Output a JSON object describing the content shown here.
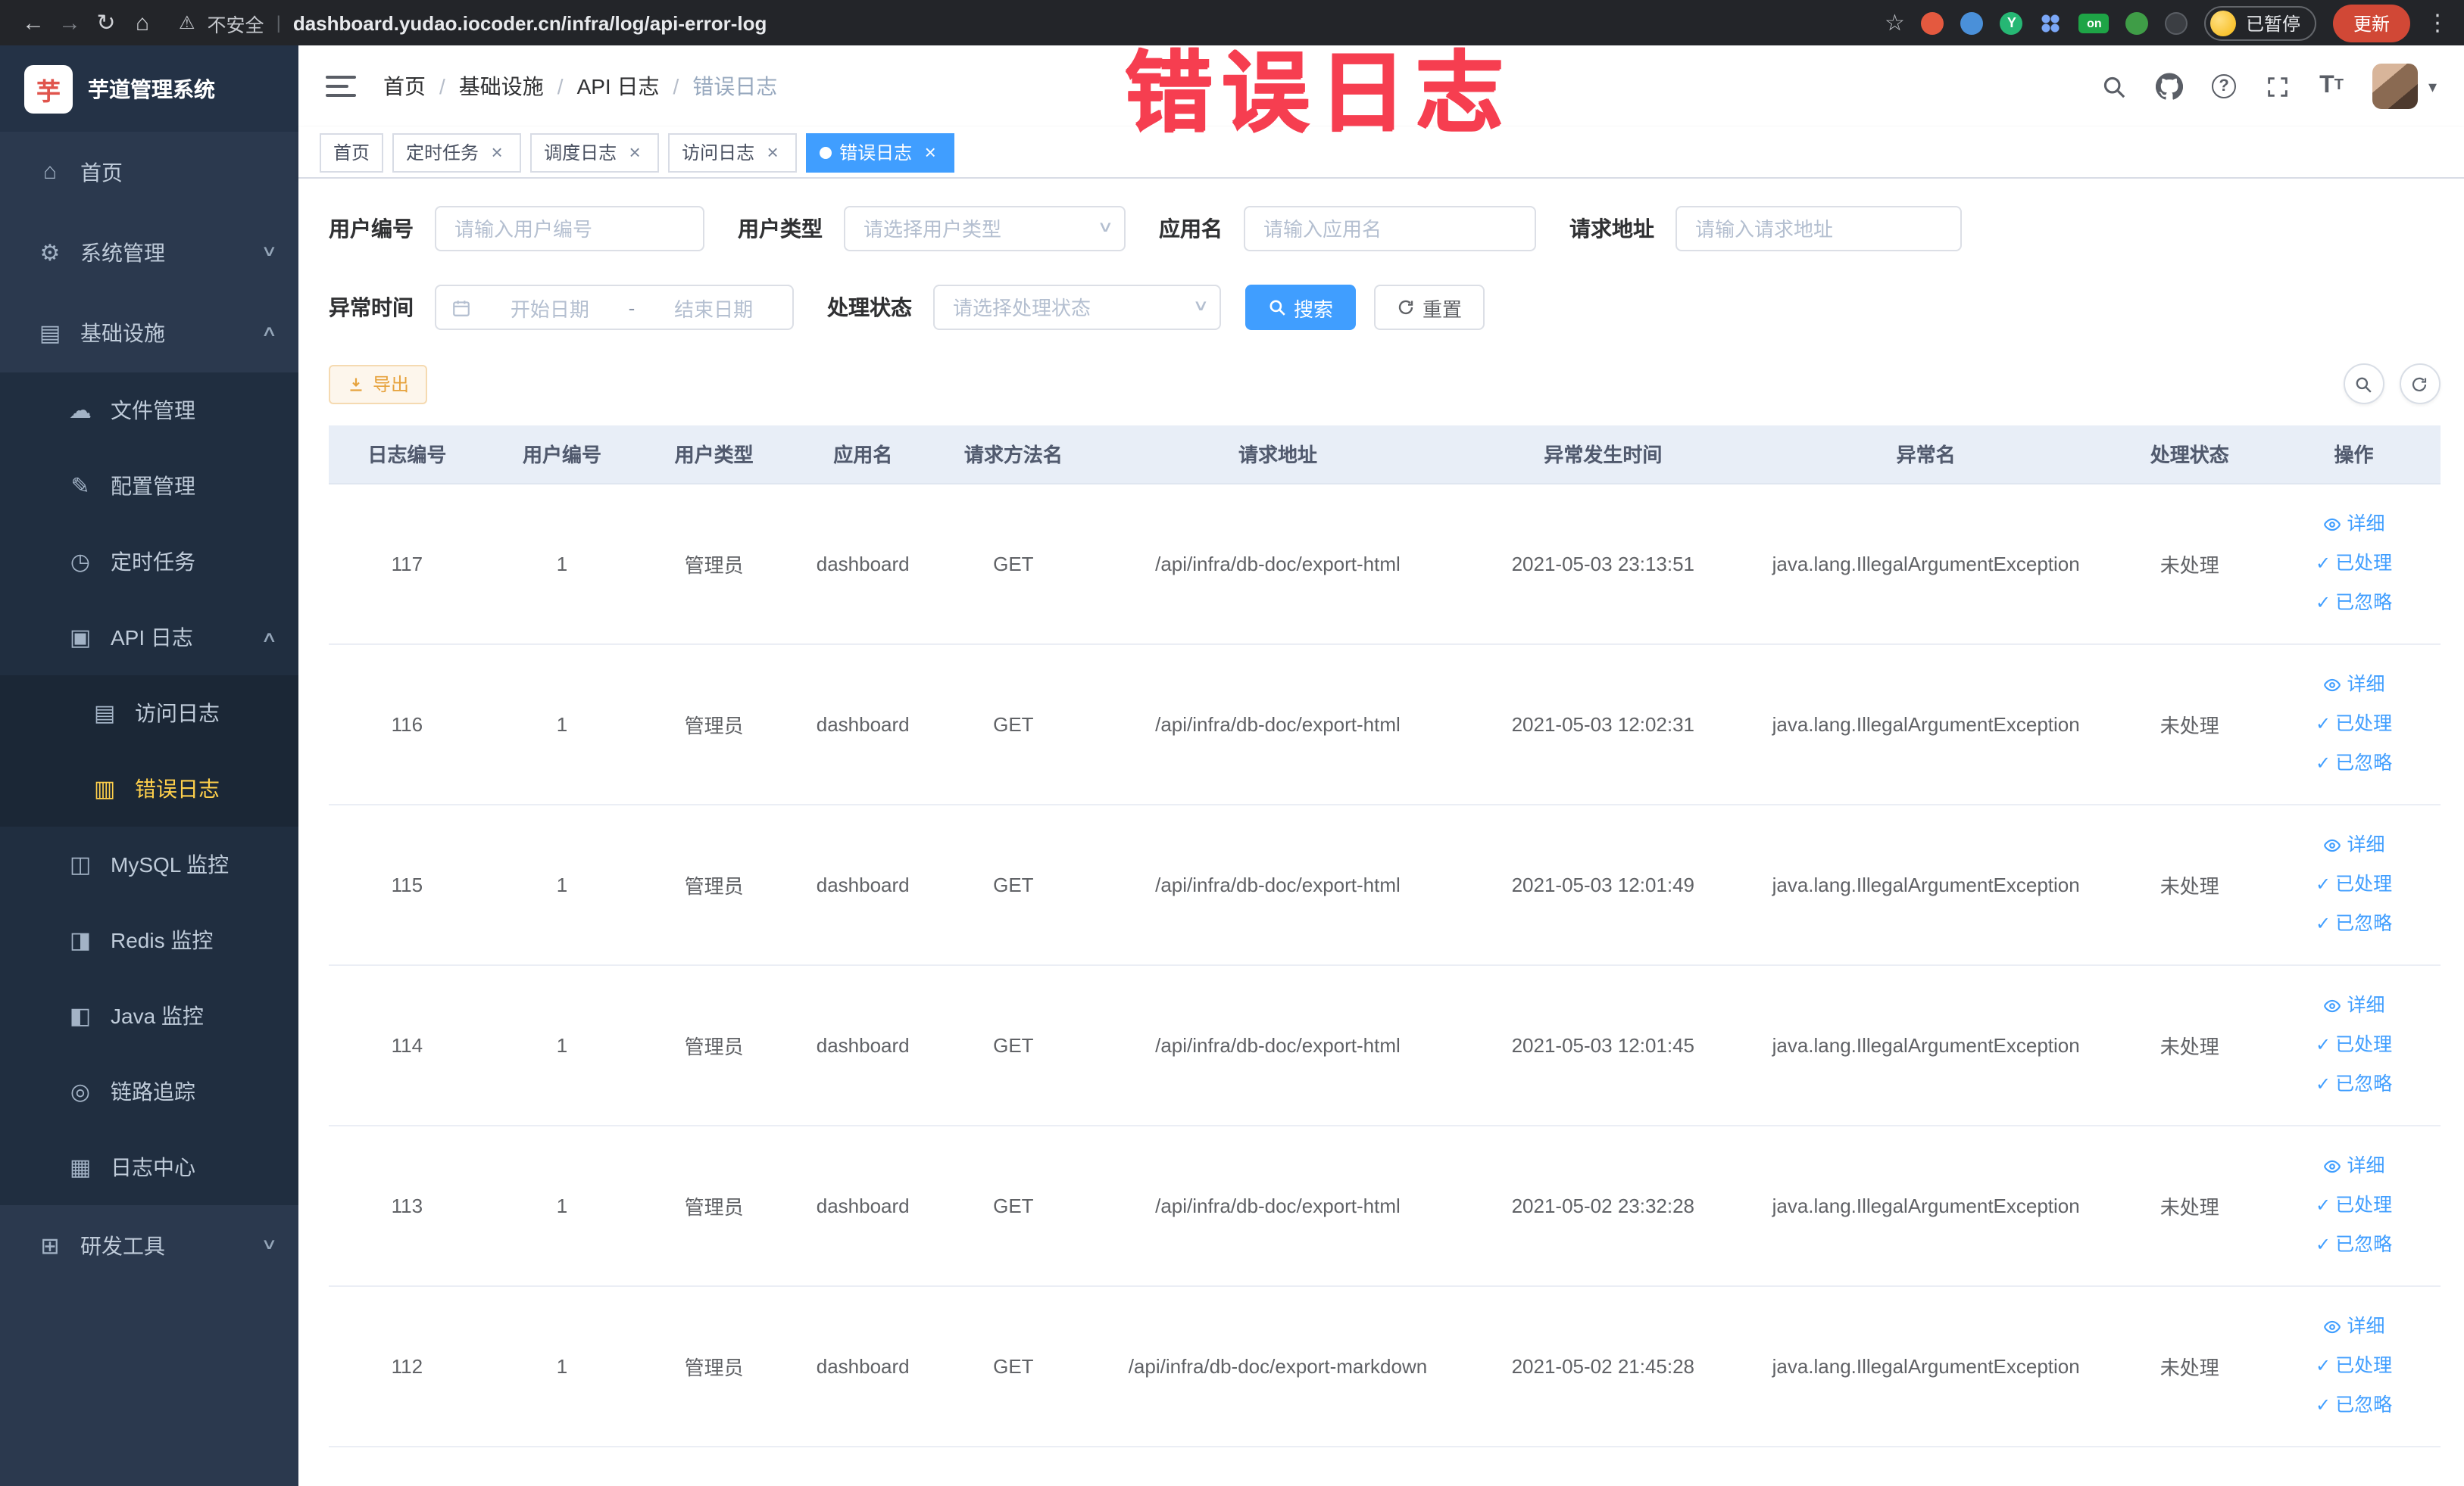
{
  "browser": {
    "security_label": "不安全",
    "url": "dashboard.yudao.iocoder.cn/infra/log/api-error-log",
    "extensions_badge": "on",
    "paused_badge": "已暂停",
    "update_button": "更新"
  },
  "overlay_title": "错误日志",
  "icons": {
    "back": "←",
    "forward": "→",
    "reload": "↻",
    "home_browser": "⌂",
    "warning": "⚠",
    "star": "☆",
    "kebab": "⋮",
    "divider": "|",
    "home": "⌂",
    "gear": "⚙",
    "infra": "▤",
    "file": "☁",
    "config": "✎",
    "timer": "◷",
    "api_log": "▣",
    "access_log": "▤",
    "error_log": "▥",
    "mysql": "◫",
    "redis": "◨",
    "java": "◧",
    "trace": "◎",
    "log_center": "▦",
    "tools": "⊞",
    "chevron_down": "∨",
    "chevron_up": "∧",
    "caret_down": "▾",
    "close": "×",
    "check": "✓",
    "select_caret": "∨"
  },
  "sidebar": {
    "logo_title": "芋道管理系统",
    "logo_glyph": "芋",
    "items": [
      {
        "label": "首页"
      },
      {
        "label": "系统管理"
      },
      {
        "label": "基础设施"
      },
      {
        "label": "文件管理"
      },
      {
        "label": "配置管理"
      },
      {
        "label": "定时任务"
      },
      {
        "label": "API 日志"
      },
      {
        "label": "访问日志"
      },
      {
        "label": "错误日志"
      },
      {
        "label": "MySQL 监控"
      },
      {
        "label": "Redis 监控"
      },
      {
        "label": "Java 监控"
      },
      {
        "label": "链路追踪"
      },
      {
        "label": "日志中心"
      },
      {
        "label": "研发工具"
      }
    ]
  },
  "header": {
    "breadcrumb": [
      "首页",
      "基础设施",
      "API 日志",
      "错误日志"
    ],
    "breadcrumb_separator": "/"
  },
  "tabs": [
    {
      "label": "首页"
    },
    {
      "label": "定时任务"
    },
    {
      "label": "调度日志"
    },
    {
      "label": "访问日志"
    },
    {
      "label": "错误日志"
    }
  ],
  "filters": {
    "user_id_label": "用户编号",
    "user_id_placeholder": "请输入用户编号",
    "user_type_label": "用户类型",
    "user_type_placeholder": "请选择用户类型",
    "app_name_label": "应用名",
    "app_name_placeholder": "请输入应用名",
    "request_url_label": "请求地址",
    "request_url_placeholder": "请输入请求地址",
    "exception_time_label": "异常时间",
    "date_start_placeholder": "开始日期",
    "date_separator": "-",
    "date_end_placeholder": "结束日期",
    "process_status_label": "处理状态",
    "process_status_placeholder": "请选择处理状态",
    "search_button": "搜索",
    "reset_button": "重置"
  },
  "toolbar": {
    "export_button": "导出"
  },
  "table": {
    "columns": [
      "日志编号",
      "用户编号",
      "用户类型",
      "应用名",
      "请求方法名",
      "请求地址",
      "异常发生时间",
      "异常名",
      "处理状态",
      "操作"
    ],
    "actions": [
      "详细",
      "已处理",
      "已忽略"
    ],
    "rows": [
      {
        "id": "117",
        "user_id": "1",
        "user_type": "管理员",
        "app": "dashboard",
        "method": "GET",
        "url": "/api/infra/db-doc/export-html",
        "time": "2021-05-03 23:13:51",
        "exception": "java.lang.IllegalArgumentException",
        "status": "未处理"
      },
      {
        "id": "116",
        "user_id": "1",
        "user_type": "管理员",
        "app": "dashboard",
        "method": "GET",
        "url": "/api/infra/db-doc/export-html",
        "time": "2021-05-03 12:02:31",
        "exception": "java.lang.IllegalArgumentException",
        "status": "未处理"
      },
      {
        "id": "115",
        "user_id": "1",
        "user_type": "管理员",
        "app": "dashboard",
        "method": "GET",
        "url": "/api/infra/db-doc/export-html",
        "time": "2021-05-03 12:01:49",
        "exception": "java.lang.IllegalArgumentException",
        "status": "未处理"
      },
      {
        "id": "114",
        "user_id": "1",
        "user_type": "管理员",
        "app": "dashboard",
        "method": "GET",
        "url": "/api/infra/db-doc/export-html",
        "time": "2021-05-03 12:01:45",
        "exception": "java.lang.IllegalArgumentException",
        "status": "未处理"
      },
      {
        "id": "113",
        "user_id": "1",
        "user_type": "管理员",
        "app": "dashboard",
        "method": "GET",
        "url": "/api/infra/db-doc/export-html",
        "time": "2021-05-02 23:32:28",
        "exception": "java.lang.IllegalArgumentException",
        "status": "未处理"
      },
      {
        "id": "112",
        "user_id": "1",
        "user_type": "管理员",
        "app": "dashboard",
        "method": "GET",
        "url": "/api/infra/db-doc/export-markdown",
        "time": "2021-05-02 21:45:28",
        "exception": "java.lang.IllegalArgumentException",
        "status": "未处理"
      }
    ]
  }
}
